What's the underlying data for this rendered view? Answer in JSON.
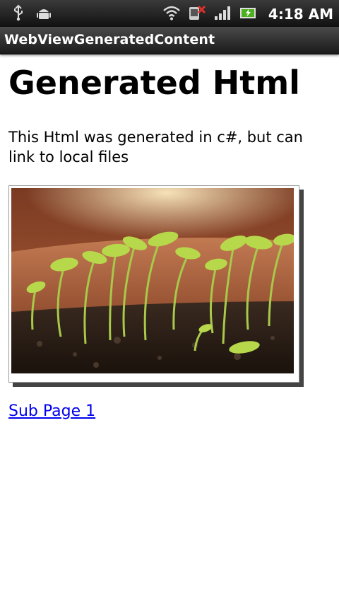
{
  "status_bar": {
    "time": "4:18 AM",
    "icons": [
      "usb-icon",
      "android-debug-icon",
      "wifi-icon",
      "no-signal-icon",
      "signal-bars-icon",
      "battery-icon"
    ]
  },
  "app": {
    "title": "WebViewGeneratedContent"
  },
  "page": {
    "heading": "Generated Html",
    "text": "This Html was generated in c#, but can link to local files",
    "image": {
      "subject": "seedlings-photo"
    },
    "link_label": "Sub Page 1"
  }
}
